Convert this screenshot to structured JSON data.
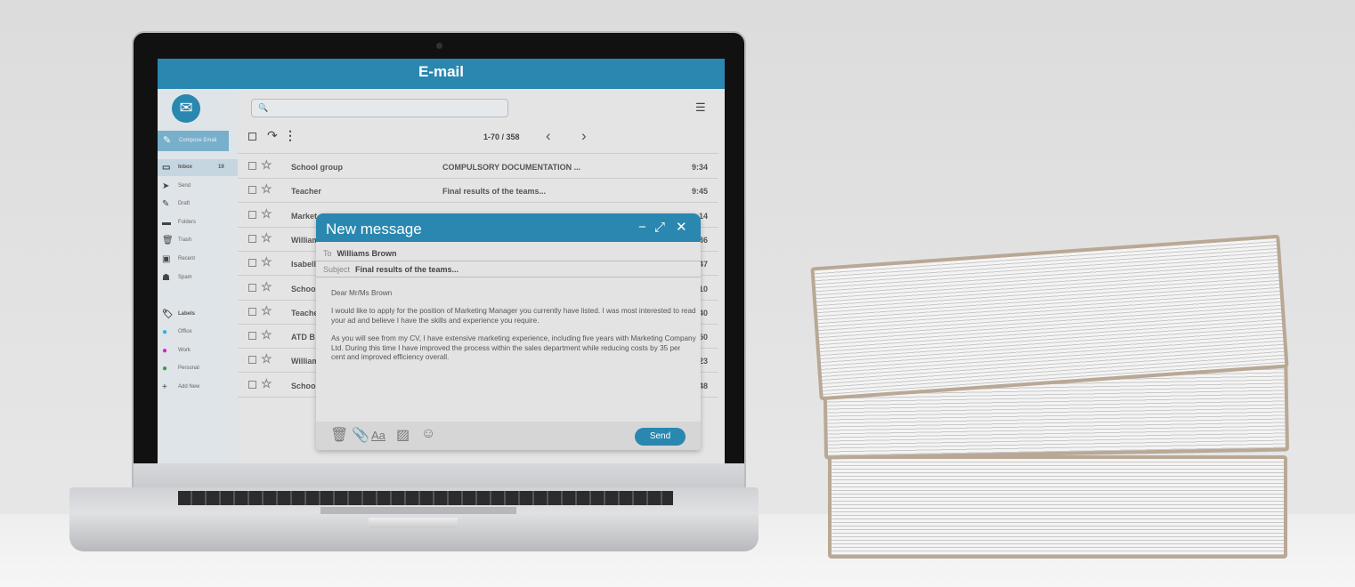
{
  "app": {
    "title": "E-mail",
    "logo_icon": "envelope-icon",
    "accent": "#2a87b0"
  },
  "sidebar": {
    "compose_label": "Compose Email",
    "items": [
      {
        "label": "Inbox",
        "icon": "inbox-icon",
        "glyph": "▭",
        "count": "19",
        "active": true
      },
      {
        "label": "Send",
        "icon": "paper-plane-icon",
        "glyph": "➤"
      },
      {
        "label": "Draft",
        "icon": "pencil-icon",
        "glyph": "✎"
      },
      {
        "label": "Folders",
        "icon": "folder-icon",
        "glyph": "▬"
      },
      {
        "label": "Trash",
        "icon": "trash-icon",
        "glyph": "🗑"
      },
      {
        "label": "Recent",
        "icon": "recent-icon",
        "glyph": "▣"
      },
      {
        "label": "Spam",
        "icon": "ghost-icon",
        "glyph": "☗"
      }
    ],
    "labels_heading": "Labels",
    "labels": [
      {
        "label": "Office",
        "icon": "tag-icon",
        "color": "#2bb5e0"
      },
      {
        "label": "Work",
        "icon": "tag-icon",
        "color": "#e020c8"
      },
      {
        "label": "Personal",
        "icon": "tag-icon",
        "color": "#3aa040"
      }
    ],
    "add_new": "Add New"
  },
  "toolbar": {
    "search_placeholder": "",
    "pagination": "1-70 / 358"
  },
  "emails": [
    {
      "sender": "School group",
      "subject": "COMPULSORY DOCUMENTATION ...",
      "time": "9:34"
    },
    {
      "sender": "Teacher",
      "subject": "Final results of the teams...",
      "time": "9:45"
    },
    {
      "sender": "Market",
      "subject": "",
      "time": "14"
    },
    {
      "sender": "William",
      "subject": "",
      "time": "36"
    },
    {
      "sender": "Isabell",
      "subject": "",
      "time": "47"
    },
    {
      "sender": "Schoo",
      "subject": "",
      "time": "10"
    },
    {
      "sender": "Teache",
      "subject": "",
      "time": "40"
    },
    {
      "sender": "ATD B",
      "subject": "",
      "time": "50"
    },
    {
      "sender": "William",
      "subject": "",
      "time": "23"
    },
    {
      "sender": "Schoo",
      "subject": "",
      "time": "48"
    }
  ],
  "compose": {
    "title": "New message",
    "to_label": "To",
    "to": "Williams Brown",
    "subject_label": "Subject",
    "subject": "Final results of the teams...",
    "body": [
      "Dear Mr/Ms Brown",
      " I would like to apply for the position of Marketing Manager you currently have listed. I was most interested to read your ad and believe I have the skills and experience you require.",
      "As you will see from my CV, I have extensive marketing experience, including five years with Marketing Company Ltd. During this time I have improved the process within the sales department while reducing costs by 35 per cent and improved efficiency overall."
    ],
    "format_label": "Aa",
    "send_label": "Send"
  }
}
